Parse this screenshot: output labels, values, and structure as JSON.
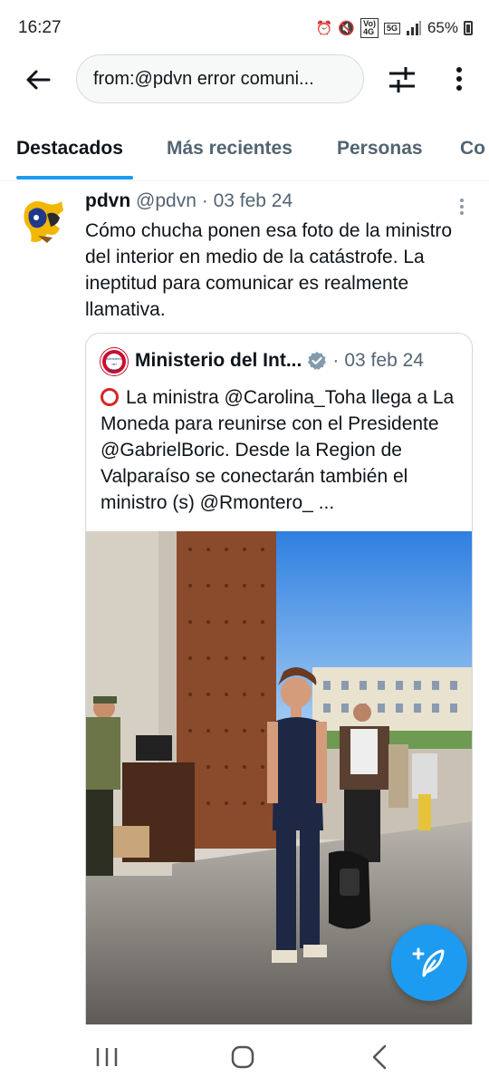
{
  "status_bar": {
    "time": "16:27",
    "net_top": "Vo)",
    "net_bottom": "4G",
    "network_5g": "5G",
    "battery": "65%",
    "icons": [
      "alarm-icon",
      "mute-icon",
      "signal-icon",
      "battery-icon"
    ]
  },
  "search": {
    "query": "from:@pdvn error comuni..."
  },
  "tabs": [
    {
      "label": "Destacados"
    },
    {
      "label": "Más recientes"
    },
    {
      "label": "Personas"
    },
    {
      "label": "Co"
    }
  ],
  "tweet": {
    "author_name": "pdvn",
    "author_handle": "@pdvn",
    "date": "03 feb 24",
    "separator": "·",
    "text": "Cómo chucha ponen esa foto de la ministro del interior en medio de la catástrofe. La ineptitud para comunicar es realmente llamativa.",
    "quote": {
      "author_name": "Ministerio del Int...",
      "avatar_text": "Ministerio del Interior",
      "date": "03 feb 24",
      "separator": "·",
      "text": "La ministra @Carolina_Toha llega a La Moneda para reunirse con el Presidente @GabrielBoric. Desde la Region de Valparaíso se conectarán también el ministro (s) @Rmontero_ ..."
    }
  },
  "colors": {
    "accent": "#1d9bf0",
    "text_primary": "#0f1419",
    "text_secondary": "#536471",
    "border": "#cfd9de",
    "red_circle": "#d9242b"
  }
}
